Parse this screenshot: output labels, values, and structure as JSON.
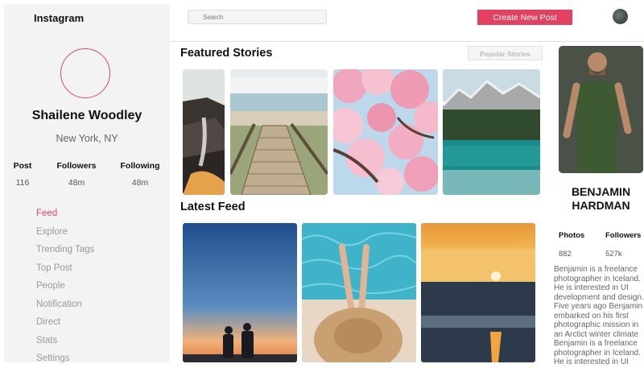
{
  "sidebar": {
    "brand": "Instagram",
    "profile": {
      "name": "Shailene Woodley",
      "location": "New York, NY",
      "stats": [
        {
          "label": "Post",
          "value": "116"
        },
        {
          "label": "Followers",
          "value": "48m"
        },
        {
          "label": "Following",
          "value": "48m"
        }
      ]
    },
    "nav": [
      {
        "label": "Feed",
        "active": true
      },
      {
        "label": "Explore"
      },
      {
        "label": "Trending Tags"
      },
      {
        "label": "Top Post"
      },
      {
        "label": "People"
      },
      {
        "label": "Notification"
      },
      {
        "label": "Direct"
      },
      {
        "label": "Stats"
      },
      {
        "label": "Settings"
      }
    ],
    "accent": "#e0466b"
  },
  "topbar": {
    "search_placeholder": "Search",
    "create_label": "Create New Post",
    "create_color": "#e4405f"
  },
  "main": {
    "featured_title": "Featured Stories",
    "popular_label": "Popular Stories",
    "featured_stories": [
      {
        "name": "rocky-waterfall-photo"
      },
      {
        "name": "beach-boardwalk-photo"
      },
      {
        "name": "cherry-blossom-photo"
      },
      {
        "name": "mountain-lake-photo"
      }
    ],
    "feed_title": "Latest Feed",
    "feed_posts": [
      {
        "name": "couple-sunset-photo"
      },
      {
        "name": "pool-sunhat-photo"
      },
      {
        "name": "ocean-sunset-photo"
      }
    ]
  },
  "author": {
    "name": "BENJAMIN HARDMAN",
    "stats": [
      {
        "label": "Photos",
        "value": "882"
      },
      {
        "label": "Followers",
        "value": "527k"
      }
    ],
    "bio": "Benjamin is a freelance photographer in Iceland. He is interested in UI development and design. Five years ago Benjamin embarked on his first photographic mission in an Arctict winter climate Benjamin is a freelance photographer in Iceland. He is interested in UI"
  }
}
